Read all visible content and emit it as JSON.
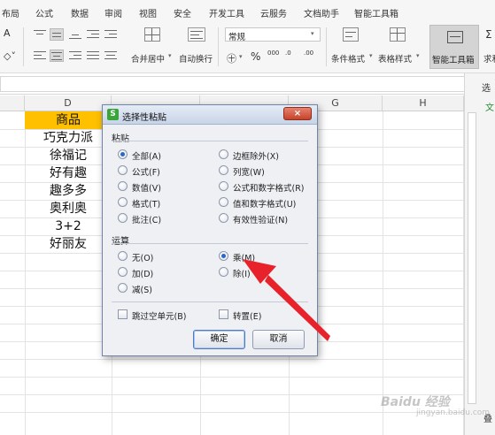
{
  "menubar": {
    "items": [
      "布局",
      "公式",
      "数据",
      "审阅",
      "视图",
      "安全",
      "开发工具",
      "云服务",
      "文档助手",
      "智能工具箱"
    ]
  },
  "ribbon": {
    "font_size_fragment": "A",
    "merge_center": "合并居中",
    "wrap_text": "自动换行",
    "number_format": "常规",
    "percent_symbol": "%",
    "thousands_symbol": "000",
    "inc_decimal": ".00",
    "dec_decimal": ".0",
    "conditional_format": "条件格式",
    "table_style": "表格样式",
    "smart_toolbox": "智能工具箱",
    "cut_fragment": "求和"
  },
  "taskpane": {
    "top_label": "选",
    "tab_label": "文",
    "bottom_label": "叠"
  },
  "grid": {
    "col_headers": [
      "D",
      "G",
      "H"
    ],
    "cells_d": [
      "商品",
      "巧克力派",
      "徐福记",
      "好有趣",
      "趣多多",
      "奥利奥",
      "3+2",
      "好丽友"
    ],
    "header_fill": "#FFC000"
  },
  "dialog": {
    "logo": "S",
    "title": "选择性粘贴",
    "close_label": "×",
    "paste_group": "粘贴",
    "paste_options_left": [
      "全部(A)",
      "公式(F)",
      "数值(V)",
      "格式(T)",
      "批注(C)"
    ],
    "paste_options_right": [
      "边框除外(X)",
      "列宽(W)",
      "公式和数字格式(R)",
      "值和数字格式(U)",
      "有效性验证(N)"
    ],
    "paste_selected": "全部(A)",
    "op_group": "运算",
    "op_options_left": [
      "无(O)",
      "加(D)",
      "减(S)"
    ],
    "op_options_right": [
      "乘(M)",
      "除(I)"
    ],
    "op_selected": "乘(M)",
    "skip_blanks": "跳过空单元(B)",
    "transpose": "转置(E)",
    "ok": "确定",
    "cancel": "取消"
  },
  "watermark": {
    "brand": "Baidu 经验",
    "url": "jingyan.baidu.com"
  }
}
